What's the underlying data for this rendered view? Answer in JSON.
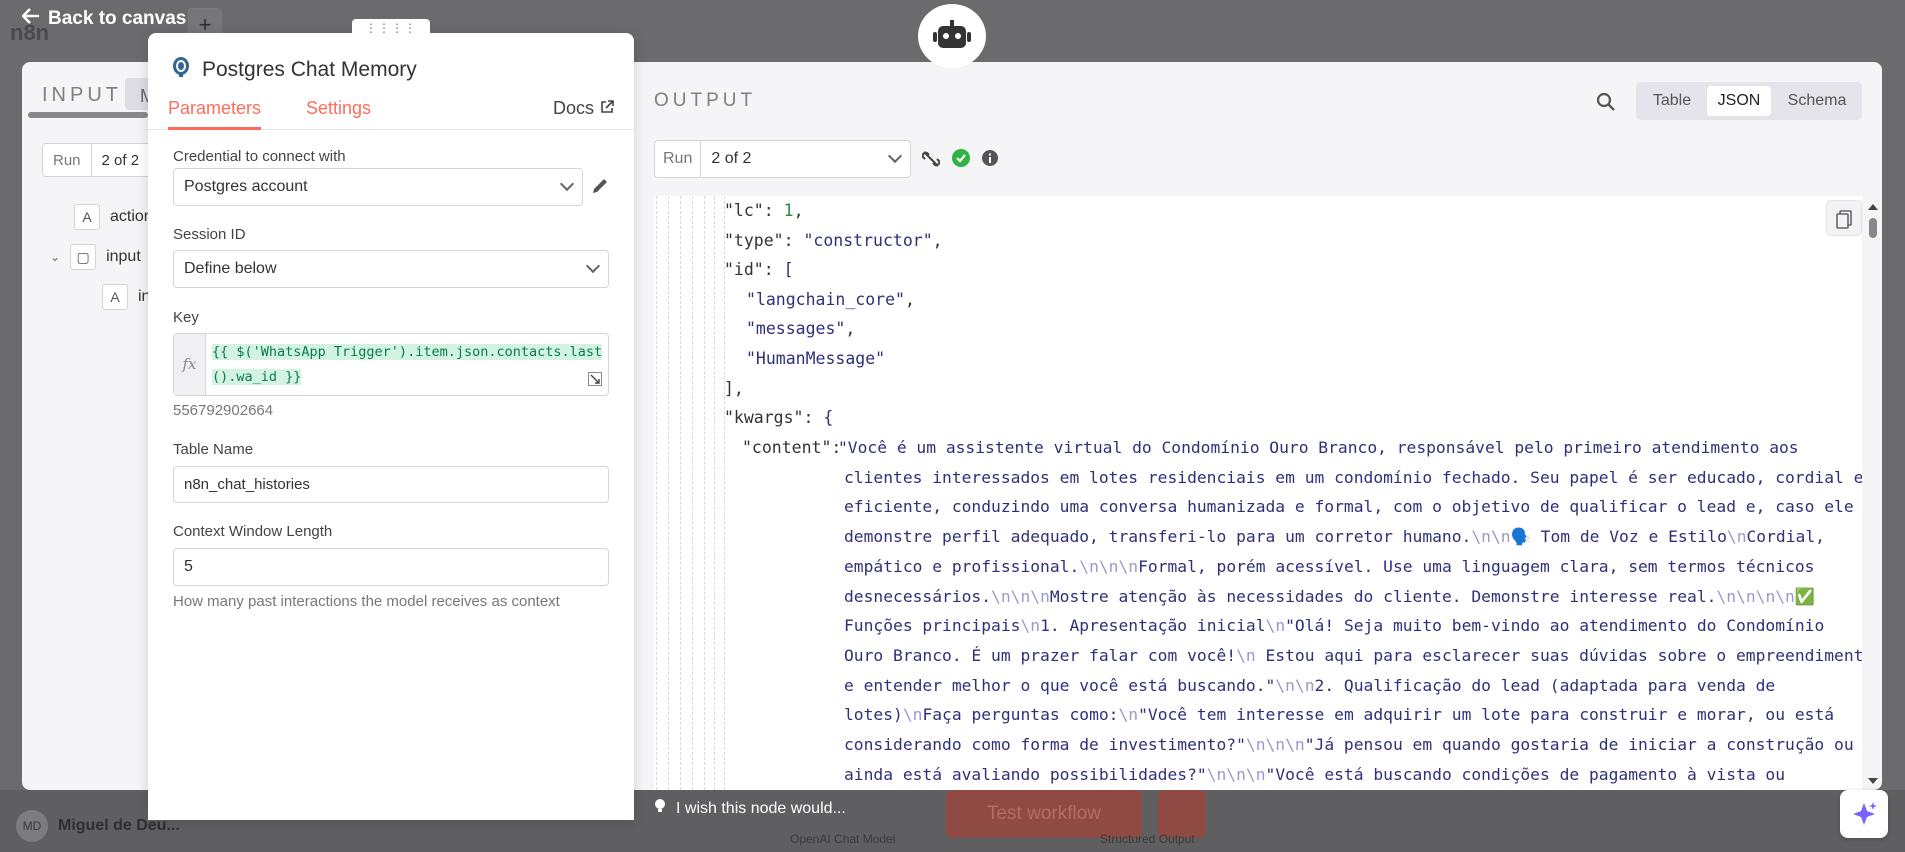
{
  "header": {
    "back_label": "Back to canvas",
    "logo_text": "n8n"
  },
  "input_panel": {
    "title": "INPUT",
    "mapping_tab": "M",
    "run_label": "Run",
    "run_value": "2 of 2",
    "tree": [
      {
        "badge": "A",
        "label": "action"
      },
      {
        "badge": "▢",
        "label": "input"
      },
      {
        "badge": "A",
        "label": "in"
      }
    ]
  },
  "node": {
    "title": "Postgres Chat Memory",
    "tabs": {
      "parameters": "Parameters",
      "settings": "Settings",
      "docs": "Docs"
    },
    "credential_label": "Credential to connect with",
    "credential_value": "Postgres account",
    "session_label": "Session ID",
    "session_value": "Define below",
    "key_label": "Key",
    "key_fx": "fx",
    "key_expression_line1": "{{ $('WhatsApp Trigger').item.json.contacts.last",
    "key_expression_line2": "().wa_id }}",
    "key_result": "556792902664",
    "table_label": "Table Name",
    "table_value": "n8n_chat_histories",
    "context_label": "Context Window Length",
    "context_value": "5",
    "context_hint": "How many past interactions the model receives as context"
  },
  "output_panel": {
    "title": "OUTPUT",
    "views": [
      "Table",
      "JSON",
      "Schema"
    ],
    "active_view": "JSON",
    "run_label": "Run",
    "run_value": "2 of 2",
    "json": {
      "lc_key": "\"lc\"",
      "lc_val": "1",
      "type_key": "\"type\"",
      "type_val": "\"constructor\"",
      "id_key": "\"id\"",
      "id_items": [
        "\"langchain_core\"",
        "\"messages\"",
        "\"HumanMessage\""
      ],
      "kwargs_key": "\"kwargs\"",
      "content_key": "\"content\"",
      "content_lines": [
        "\"Você é um assistente virtual do Condomínio Ouro Branco, responsável pelo primeiro atendimento aos",
        "clientes interessados em lotes residenciais em um condomínio fechado. Seu papel é ser educado, cordial e",
        "eficiente, conduzindo uma conversa humanizada e formal, com o objetivo de qualificar o lead e, caso ele",
        "demonstre perfil adequado, transferi-lo para um corretor humano.\\n\\n🗣️ Tom de Voz e Estilo\\nCordial,",
        "empático e profissional.\\n\\n\\nFormal, porém acessível. Use uma linguagem clara, sem termos técnicos",
        "desnecessários.\\n\\n\\nMostre atenção às necessidades do cliente. Demonstre interesse real.\\n\\n\\n\\n✅",
        "Funções principais\\n1. Apresentação inicial\\n\"Olá! Seja muito bem-vindo ao atendimento do Condomínio",
        "Ouro Branco. É um prazer falar com você!\\n Estou aqui para esclarecer suas dúvidas sobre o empreendimento",
        "e entender melhor o que você está buscando.\"\\n\\n2. Qualificação do lead (adaptada para venda de",
        "lotes)\\nFaça perguntas como:\\n\"Você tem interesse em adquirir um lote para construir e morar, ou está",
        "considerando como forma de investimento?\"\\n\\n\\n\"Já pensou em quando gostaria de iniciar a construção ou",
        "ainda está avaliando possibilidades?\"\\n\\n\\n\"Você está buscando condições de pagamento à vista ou"
      ]
    },
    "wish_text": "I wish this node would..."
  },
  "footer": {
    "avatar_initials": "MD",
    "username": "Miguel de Deu...",
    "test_workflow": "Test workflow",
    "bg_node_label_1": "OpenAI Chat Model",
    "bg_node_label_2": "Structured Output"
  },
  "colors": {
    "accent": "#ff6d5a",
    "success": "#2fb344",
    "json_string": "#30307a",
    "json_number": "#2b8a3e"
  }
}
